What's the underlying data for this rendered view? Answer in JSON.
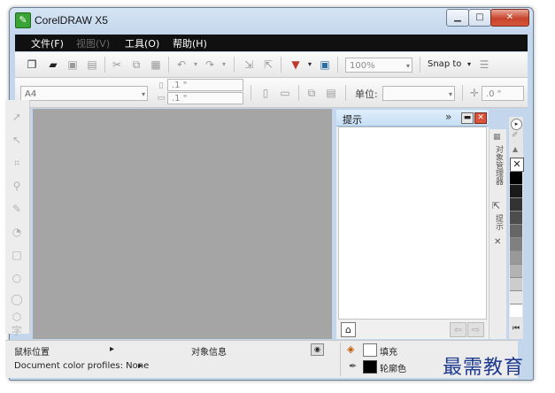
{
  "window": {
    "title": "CorelDRAW X5"
  },
  "menus": [
    "文件(F)",
    "视图(V)",
    "工具(O)",
    "帮助(H)"
  ],
  "toolbar": {
    "zoom_value": "100%",
    "snap_label": "Snap to"
  },
  "property_bar": {
    "page_size": "A4",
    "nudge_x": ".1 \"",
    "nudge_y": ".1 \"",
    "units_label": "单位:",
    "offset_value": ".0 \""
  },
  "docker": {
    "title": "提示",
    "side_tabs": [
      "对象管理器",
      "提示"
    ]
  },
  "palette": {
    "colors": [
      "#000000",
      "#1a1a1a",
      "#333333",
      "#4d4d4d",
      "#666666",
      "#808080",
      "#999999",
      "#b3b3b3",
      "#cccccc",
      "#e6e6e6",
      "#ffffff"
    ]
  },
  "status": {
    "cursor_position": "鼠标位置",
    "object_info": "对象信息",
    "color_profiles": "Document color profiles: None",
    "fill_label": "填充",
    "outline_label": "轮廓色"
  },
  "watermark": "最需教育"
}
